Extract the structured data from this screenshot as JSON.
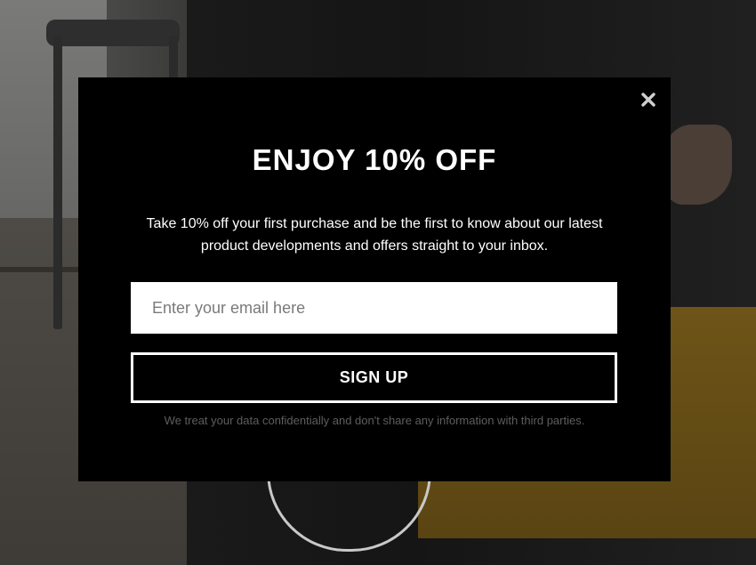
{
  "popup": {
    "title": "ENJOY 10% OFF",
    "description": "Take 10% off your first purchase and be the first to know about our latest product developments and offers straight to your inbox.",
    "email_placeholder": "Enter your email here",
    "email_value": "",
    "signup_label": "SIGN UP",
    "disclaimer": "We treat your data confidentially and don't share any information with third parties.",
    "close_icon": "close-icon"
  },
  "colors": {
    "modal_background": "#000000",
    "text": "#ffffff",
    "disclaimer_text": "#5e5e5e",
    "input_background": "#ffffff",
    "close_icon": "#cfcfcf"
  }
}
